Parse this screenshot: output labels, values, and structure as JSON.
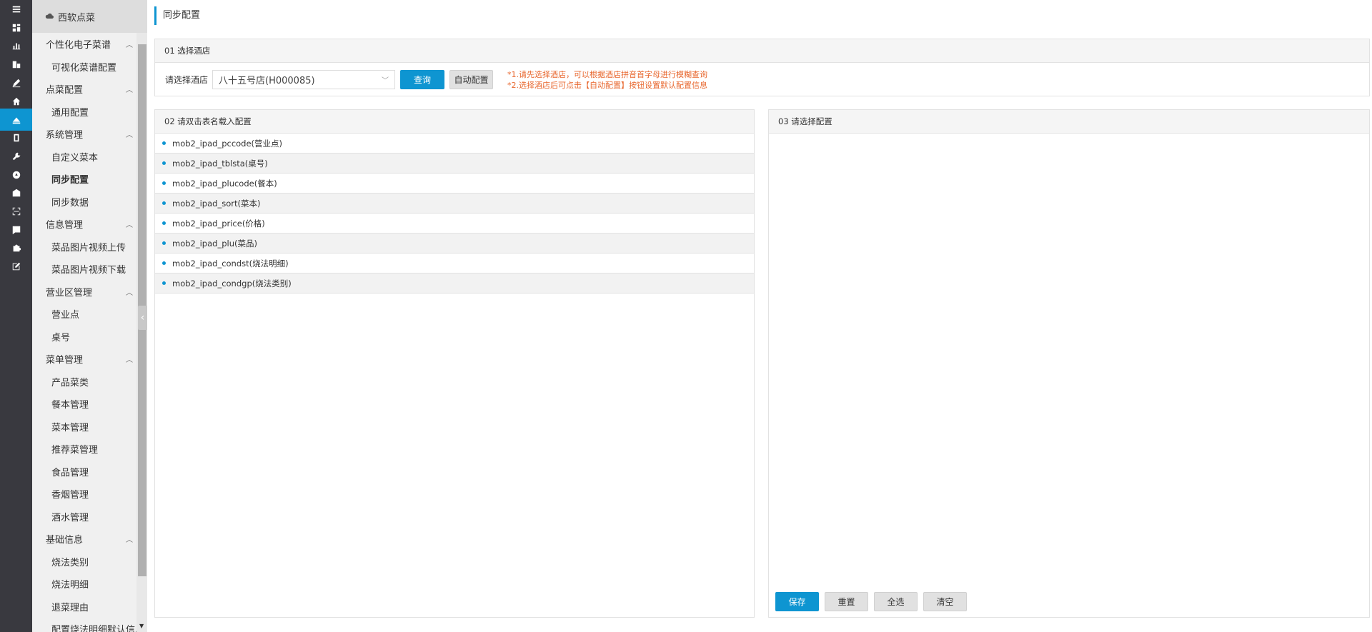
{
  "rail": {
    "icons": [
      "menu-icon",
      "dashboard-icon",
      "bar-chart-icon",
      "building-icon",
      "pen-icon",
      "home-icon",
      "cloud-icon",
      "tablet-icon",
      "wrench-icon",
      "gauge-icon",
      "mailbox-icon",
      "scan-icon",
      "document-icon",
      "puzzle-icon",
      "edit-icon"
    ],
    "active_index": 6
  },
  "sidebar": {
    "header": "西软点菜",
    "groups": [
      {
        "label": "个性化电子菜谱",
        "items": [
          "可视化菜谱配置"
        ]
      },
      {
        "label": "点菜配置",
        "items": [
          "通用配置"
        ]
      },
      {
        "label": "系统管理",
        "items": [
          "自定义菜本",
          "同步配置",
          "同步数据"
        ]
      },
      {
        "label": "信息管理",
        "items": [
          "菜品图片视频上传",
          "菜品图片视频下载"
        ]
      },
      {
        "label": "营业区管理",
        "items": [
          "营业点",
          "桌号"
        ]
      },
      {
        "label": "菜单管理",
        "items": [
          "产品菜类",
          "餐本管理",
          "菜本管理",
          "推荐菜管理",
          "食品管理",
          "香烟管理",
          "酒水管理"
        ]
      },
      {
        "label": "基础信息",
        "items": [
          "烧法类别",
          "烧法明细",
          "退菜理由",
          "配置烧法明细默认信息"
        ]
      }
    ],
    "active_item": "同步配置"
  },
  "page": {
    "title": "同步配置"
  },
  "panel1": {
    "title": "01 选择酒店",
    "hotel_label": "请选择酒店",
    "hotel_value": "八十五号店(H000085)",
    "query_button": "查询",
    "auto_button": "自动配置",
    "tip1": "*1.请先选择酒店，可以根据酒店拼音首字母进行模糊查询",
    "tip2": "*2.选择酒店后可点击【自动配置】按钮设置默认配置信息"
  },
  "panel2": {
    "title": "02 请双击表名载入配置",
    "tables": [
      "mob2_ipad_pccode(营业点)",
      "mob2_ipad_tblsta(桌号)",
      "mob2_ipad_plucode(餐本)",
      "mob2_ipad_sort(菜本)",
      "mob2_ipad_price(价格)",
      "mob2_ipad_plu(菜品)",
      "mob2_ipad_condst(烧法明细)",
      "mob2_ipad_condgp(烧法类别)"
    ]
  },
  "panel3": {
    "title": "03 请选择配置",
    "save_button": "保存",
    "reset_button": "重置",
    "select_all_button": "全选",
    "clear_button": "清空"
  },
  "colors": {
    "accent": "#0e95d1",
    "rail_bg": "#39393f",
    "tip": "#e8672e"
  }
}
